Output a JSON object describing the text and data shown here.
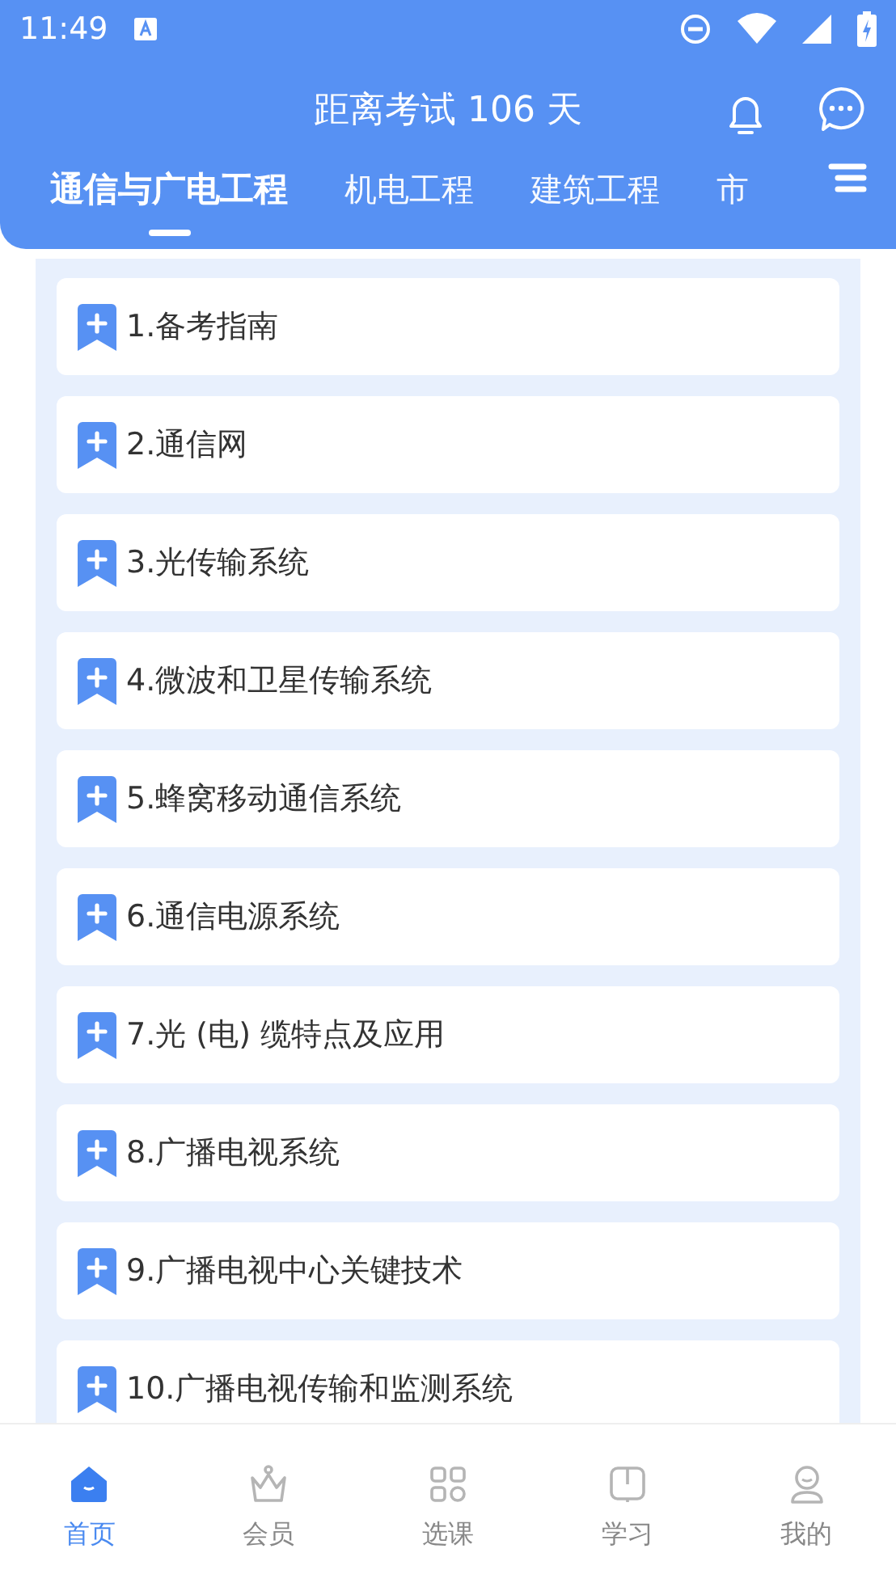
{
  "status_bar": {
    "time": "11:49"
  },
  "header": {
    "title": "距离考试 106 天"
  },
  "tabs": [
    {
      "label": "通信与广电工程",
      "selected": true
    },
    {
      "label": "机电工程",
      "selected": false
    },
    {
      "label": "建筑工程",
      "selected": false
    },
    {
      "label": "市",
      "selected": false
    }
  ],
  "chapters": [
    {
      "title": "1.备考指南"
    },
    {
      "title": "2.通信网"
    },
    {
      "title": "3.光传输系统"
    },
    {
      "title": "4.微波和卫星传输系统"
    },
    {
      "title": "5.蜂窝移动通信系统"
    },
    {
      "title": "6.通信电源系统"
    },
    {
      "title": "7.光 (电) 缆特点及应用"
    },
    {
      "title": "8.广播电视系统"
    },
    {
      "title": "9.广播电视中心关键技术"
    },
    {
      "title": "10.广播电视传输和监测系统"
    }
  ],
  "bottom_nav": [
    {
      "label": "首页",
      "selected": true
    },
    {
      "label": "会员",
      "selected": false
    },
    {
      "label": "选课",
      "selected": false
    },
    {
      "label": "学习",
      "selected": false
    },
    {
      "label": "我的",
      "selected": false
    }
  ]
}
